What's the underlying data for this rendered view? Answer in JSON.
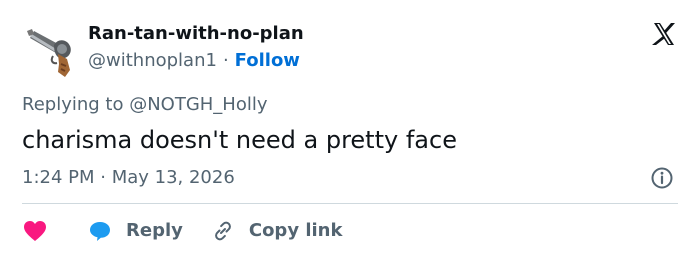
{
  "user": {
    "display_name": "Ran-tan-with-no-plan",
    "handle": "@withnoplan1",
    "separator": "·",
    "follow_label": "Follow"
  },
  "tweet": {
    "reply_context": "Replying to @NOTGH_Holly",
    "text": "charisma doesn't need a pretty face",
    "timestamp": "1:24 PM · May 13, 2026"
  },
  "actions": {
    "reply_label": "Reply",
    "copy_link_label": "Copy link"
  },
  "icons": {
    "avatar": "revolver-avatar",
    "brand": "x-logo-icon",
    "info": "info-icon",
    "like": "heart-icon",
    "reply": "speech-bubble-icon",
    "copy": "link-icon"
  },
  "colors": {
    "text": "#0f1419",
    "secondary": "#536471",
    "follow": "#006fd6",
    "like": "#f91880",
    "reply": "#1d9bf0",
    "divider": "#cfd9de"
  }
}
